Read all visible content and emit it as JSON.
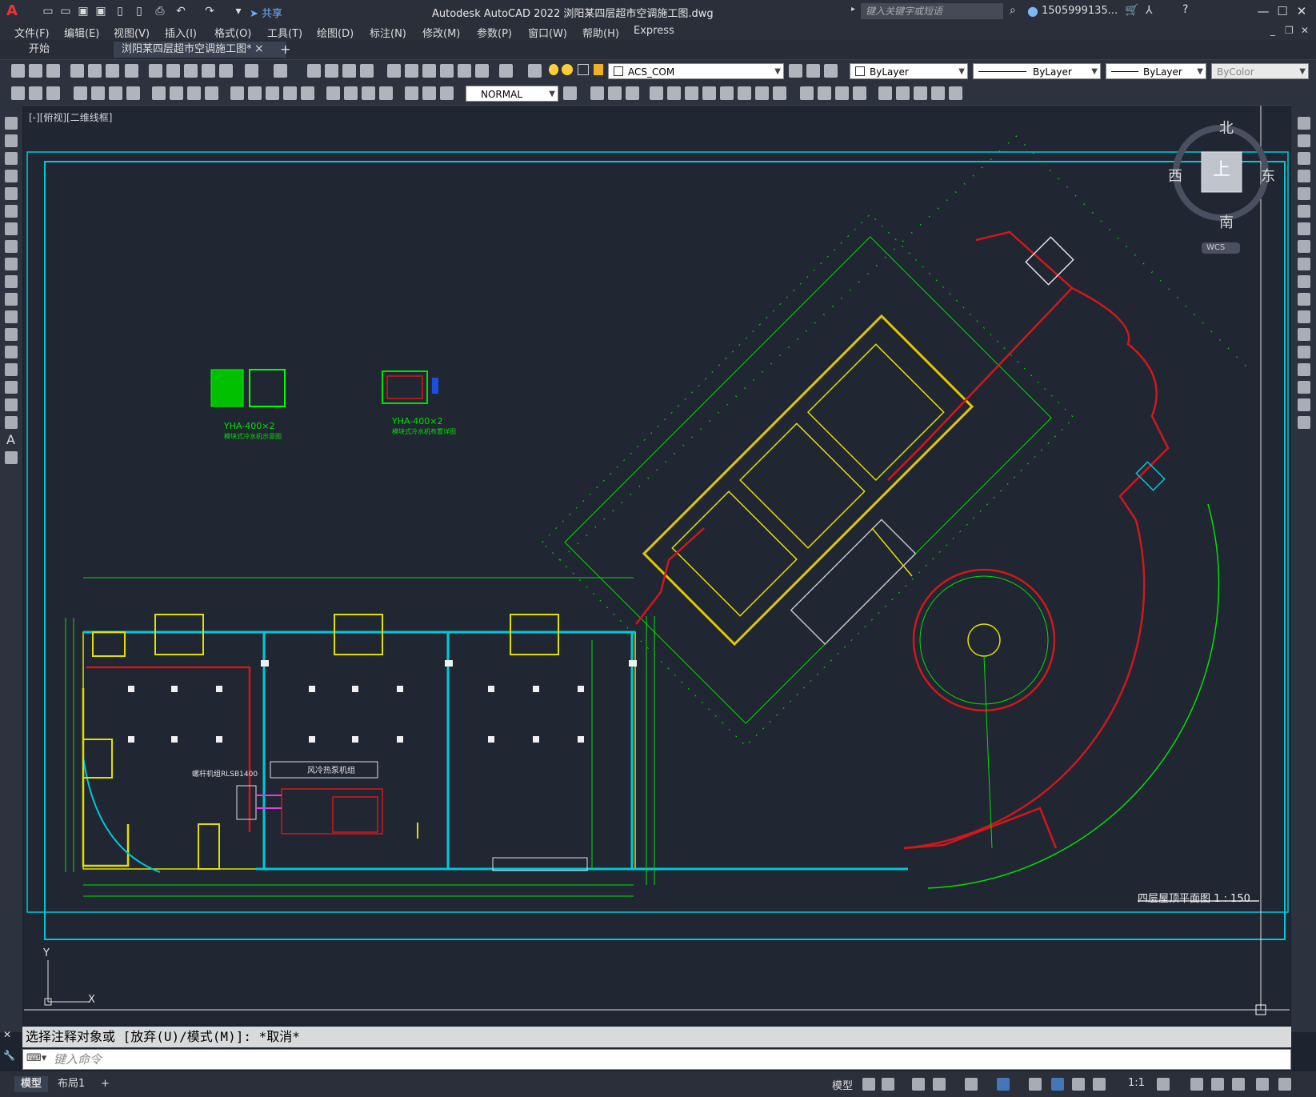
{
  "titlebar": {
    "app_title": "Autodesk AutoCAD 2022    浏阳某四层超市空调施工图.dwg",
    "share_label": "共享",
    "search_placeholder": "键入关键字或短语",
    "user_name": "1505999135...",
    "minimize": "—",
    "maximize": "☐",
    "close": "✕"
  },
  "menubar": {
    "items": [
      "文件(F)",
      "编辑(E)",
      "视图(V)",
      "插入(I)",
      "格式(O)",
      "工具(T)",
      "绘图(D)",
      "标注(N)",
      "修改(M)",
      "参数(P)",
      "窗口(W)",
      "帮助(H)",
      "Express"
    ]
  },
  "tabs": {
    "start": "开始",
    "active": "浏阳某四层超市空调施工图*",
    "close": "×",
    "add": "+"
  },
  "toolbar1": {
    "layer_value": "ACS_COM",
    "color_value": "ByLayer",
    "linetype_value": "ByLayer",
    "lineweight_value": "ByLayer",
    "plotstyle_value": "ByColor"
  },
  "toolbar2": {
    "dimstyle_value": "NORMAL"
  },
  "viewport": {
    "label": "[-][俯视][二维线框]"
  },
  "viewcube": {
    "north": "北",
    "south": "南",
    "east": "东",
    "west": "西",
    "top": "上",
    "wcs": "WCS"
  },
  "drawing": {
    "sheet_title": "四层屋顶平面图 1 : 150",
    "unit1_label": "YHA-400×2",
    "unit1_caption": "模块式冷水机示意图",
    "unit2_label": "YHA-400×2",
    "unit2_caption": "模块式冷水机布置详图",
    "fan_label": "螺杆机组RLSB1400",
    "ahu_label": "风冷热泵机组",
    "ucs_x": "X",
    "ucs_y": "Y"
  },
  "command": {
    "history": "选择注释对象或 [放弃(U)/模式(M)]: *取消*",
    "placeholder": "键入命令"
  },
  "statusbar": {
    "model_tab": "模型",
    "layout_tab": "布局1",
    "add_tab": "+",
    "model_space": "模型",
    "scale": "1:1"
  }
}
